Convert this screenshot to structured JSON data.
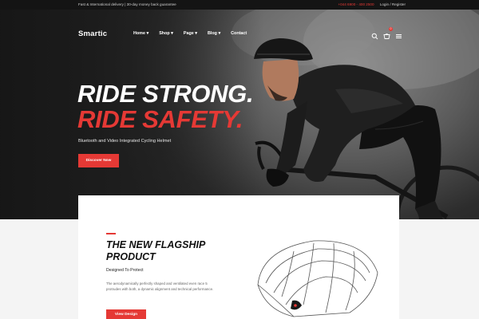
{
  "topbar": {
    "left_text": "Fast & International delivery  |  30-day money back guarantee",
    "phone": "+044 6900 - 400 2500",
    "account": "Login / Register"
  },
  "brand": {
    "logo": "Smartic"
  },
  "nav": {
    "items": [
      {
        "label": "Home ▾"
      },
      {
        "label": "Shop ▾"
      },
      {
        "label": "Page ▾"
      },
      {
        "label": "Blog ▾"
      },
      {
        "label": "Contact"
      }
    ],
    "cart_count": "0",
    "icons": [
      "search-icon",
      "cart-icon",
      "menu-icon"
    ]
  },
  "hero": {
    "headline_line1": "RIDE STRONG.",
    "headline_line2": "RIDE SAFETY.",
    "subtitle": "Bluetooth and Video Integrated Cycling Helmet",
    "cta": "Discover Now"
  },
  "product": {
    "title_line1": "THE NEW FLAGSHIP",
    "title_line2": "PRODUCT",
    "subtitle": "Designed To Protect",
    "description": "The aerodynamically perfectly shaped and ventilated even race 5 protrudes with both, a dynamic alignment and technical performance.",
    "cta": "View Design"
  },
  "colors": {
    "accent": "#e53935",
    "dark": "#141414",
    "light_bg": "#f4f4f4"
  }
}
